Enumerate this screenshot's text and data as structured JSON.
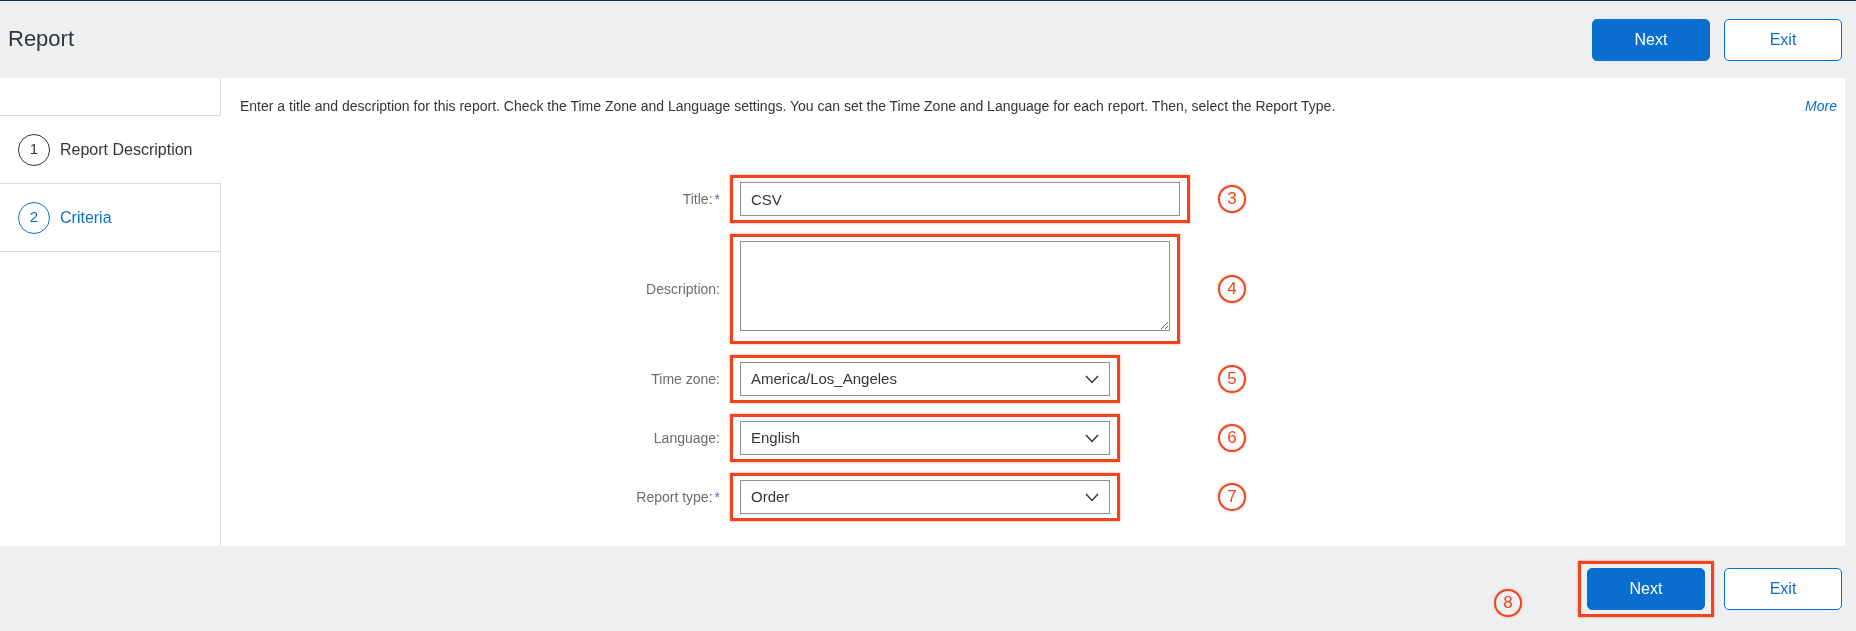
{
  "header": {
    "title": "Report",
    "buttons": [
      {
        "label": "Next",
        "kind": "primary"
      },
      {
        "label": "Exit",
        "kind": "secondary"
      }
    ]
  },
  "steps": [
    {
      "number": "1",
      "label": "Report Description",
      "selected": true
    },
    {
      "number": "2",
      "label": "Criteria",
      "selected": false
    }
  ],
  "instructions": "Enter a title and description for this report. Check the Time Zone and Language settings. You can set the Time Zone and Language for each report. Then, select the Report Type.",
  "more_link": "More",
  "form": {
    "fields": [
      {
        "label": "Title:",
        "required_mark": "*",
        "kind": "text",
        "value": "CSV",
        "annotation": "3"
      },
      {
        "label": "Description:",
        "kind": "textarea",
        "annotation": "4"
      },
      {
        "label": "Time zone:",
        "kind": "select",
        "value": "America/Los_Angeles",
        "annotation": "5"
      },
      {
        "label": "Language:",
        "kind": "select",
        "value": "English",
        "annotation": "6"
      },
      {
        "label": "Report type:",
        "required_mark": "*",
        "kind": "select",
        "value": "Order",
        "annotation": "7"
      }
    ]
  },
  "footer": {
    "buttons": [
      {
        "label": "Next",
        "kind": "primary",
        "annotation": "8"
      },
      {
        "label": "Exit",
        "kind": "secondary"
      }
    ]
  }
}
